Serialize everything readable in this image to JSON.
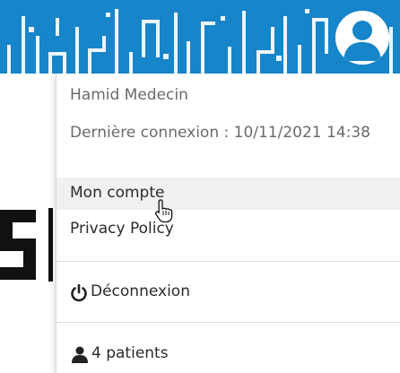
{
  "header": {
    "banner_color": "#1785c9",
    "avatar_icon": "user-avatar-icon"
  },
  "user_menu": {
    "user_name": "Hamid Medecin",
    "last_login": "Dernière connexion : 10/11/2021 14:38",
    "items": [
      {
        "label": "Mon compte",
        "highlighted": true
      },
      {
        "label": "Privacy Policy"
      }
    ],
    "logout": {
      "label": "Déconnexion",
      "icon": "power-icon"
    },
    "patient_count": {
      "label": "4 patients",
      "icon": "user-icon"
    }
  },
  "cursor": {
    "icon": "hand-pointer-cursor"
  }
}
